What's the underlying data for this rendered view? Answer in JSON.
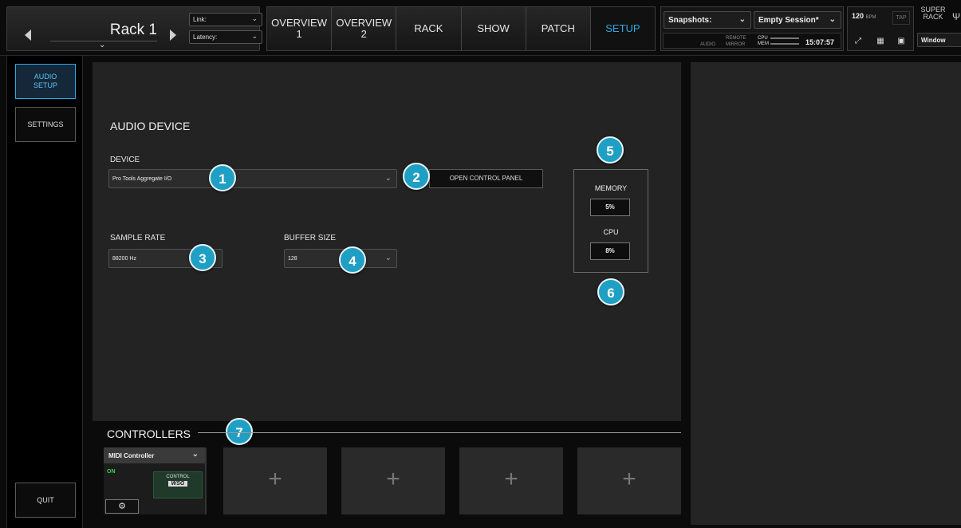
{
  "header": {
    "rack_title": "Rack 1",
    "link_label": "Link:",
    "latency_label": "Latency:",
    "tabs": [
      {
        "line1": "OVERVIEW",
        "line2": "1"
      },
      {
        "line1": "OVERVIEW",
        "line2": "2"
      },
      {
        "line1": "RACK",
        "line2": ""
      },
      {
        "line1": "SHOW",
        "line2": ""
      },
      {
        "line1": "PATCH",
        "line2": ""
      },
      {
        "line1": "SETUP",
        "line2": ""
      }
    ],
    "snapshots_label": "Snapshots:",
    "session_label": "Empty Session*",
    "status": {
      "audio": "AUDIO",
      "remote": "REMOTE",
      "mirror": "MIRROR",
      "cpu": "CPU",
      "mem": "MEM",
      "clock": "15:07:57"
    },
    "bpm_value": "120",
    "bpm_unit": "BPM",
    "tap_label": "TAP",
    "superrack_line1": "SUPER",
    "superrack_line2": "RACK",
    "window_label": "Window"
  },
  "sidebar": {
    "audio_setup_line1": "AUDIO",
    "audio_setup_line2": "SETUP",
    "settings_label": "SETTINGS",
    "quit_label": "QUIT"
  },
  "audio_device": {
    "heading": "AUDIO DEVICE",
    "device_label": "DEVICE",
    "device_value": "Pro Tools Aggregate I/O",
    "control_panel_button": "OPEN CONTROL PANEL",
    "sample_rate_label": "SAMPLE RATE",
    "sample_rate_value": "88200 Hz",
    "buffer_size_label": "BUFFER SIZE",
    "buffer_size_value": "128",
    "memory_label": "MEMORY",
    "memory_value": "5%",
    "cpu_label": "CPU",
    "cpu_value": "8%"
  },
  "badges": [
    "1",
    "2",
    "3",
    "4",
    "5",
    "6",
    "7"
  ],
  "controllers": {
    "heading": "CONTROLLERS",
    "card_name": "MIDI Controller",
    "card_status": "ON",
    "card_logo_top": "CONTROL",
    "card_logo_bottom": "WSG",
    "add_symbol": "+"
  },
  "colors": {
    "accent": "#2fa7e0",
    "badge": "#1f9fc4",
    "status_on": "#3ad54f"
  }
}
